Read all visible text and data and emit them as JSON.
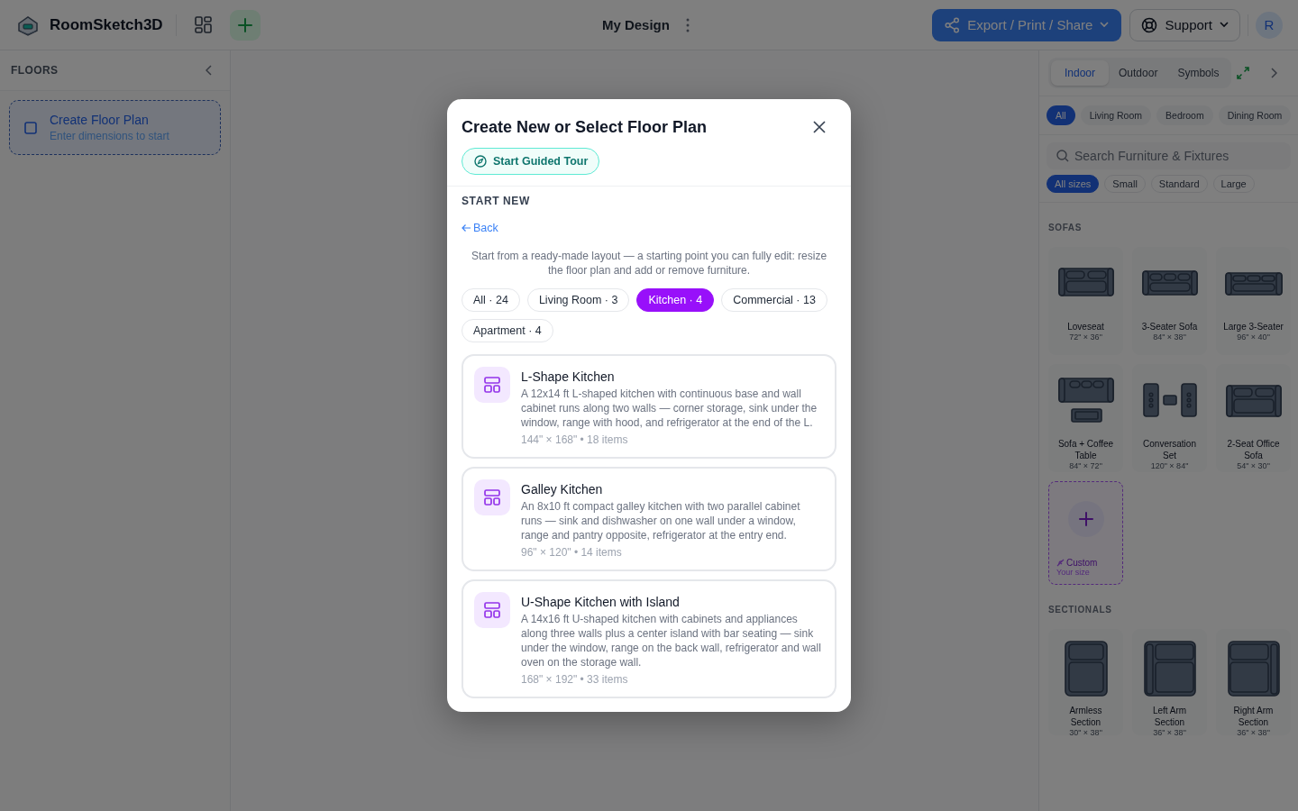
{
  "header": {
    "logo_text": "RoomSketch3D",
    "title": "My Design",
    "export_button": "Export / Print / Share",
    "support_button": "Support",
    "avatar": "R"
  },
  "sidebar": {
    "heading": "FLOORS",
    "create_card": {
      "title": "Create Floor Plan",
      "subtitle": "Enter dimensions to start"
    }
  },
  "library": {
    "tabs": [
      {
        "label": "Indoor",
        "selected": true
      },
      {
        "label": "Outdoor",
        "selected": false
      },
      {
        "label": "Symbols",
        "selected": false
      }
    ],
    "categories": [
      {
        "label": "All",
        "selected": true
      },
      {
        "label": "Living Room",
        "selected": false
      },
      {
        "label": "Bedroom",
        "selected": false
      },
      {
        "label": "Dining Room",
        "selected": false
      }
    ],
    "search": {
      "placeholder": "Search Furniture & Fixtures"
    },
    "sizes": [
      {
        "label": "All sizes",
        "selected": true
      },
      {
        "label": "Small",
        "selected": false
      },
      {
        "label": "Standard",
        "selected": false
      },
      {
        "label": "Large",
        "selected": false
      }
    ],
    "sections": [
      {
        "heading": "SOFAS",
        "items": [
          {
            "kind": "loveseat",
            "name": "Loveseat",
            "size": "72\" × 36\""
          },
          {
            "kind": "sofa3",
            "name": "3-Seater Sofa",
            "size": "84\" × 38\""
          },
          {
            "kind": "large3",
            "name": "Large 3-Seater",
            "size": "96\" × 40\""
          },
          {
            "kind": "sofa-table",
            "name": "Sofa + Coffee Table",
            "size": "84\" × 72\""
          },
          {
            "kind": "conversation",
            "name": "Conversation Set",
            "size": "120\" × 84\""
          },
          {
            "kind": "office2",
            "name": "2-Seat Office Sofa",
            "size": "54\" × 30\""
          },
          {
            "kind": "custom",
            "name": "Custom",
            "size": "Your size"
          }
        ]
      },
      {
        "heading": "SECTIONALS",
        "items": [
          {
            "kind": "armless",
            "name": "Armless Section",
            "size": "30\" × 38\""
          },
          {
            "kind": "left-arm",
            "name": "Left Arm Section",
            "size": "36\" × 38\""
          },
          {
            "kind": "right-arm",
            "name": "Right Arm Section",
            "size": "36\" × 38\""
          }
        ]
      }
    ]
  },
  "modal": {
    "title": "Create New or Select Floor Plan",
    "tour_button": "Start Guided Tour",
    "section_label": "START NEW",
    "back_link": "Back",
    "description": "Start from a ready-made layout — a starting point you can fully edit: resize the floor plan and add or remove furniture.",
    "filters": [
      {
        "label": "All · 24",
        "selected": false
      },
      {
        "label": "Living Room · 3",
        "selected": false
      },
      {
        "label": "Kitchen · 4",
        "selected": true
      },
      {
        "label": "Commercial · 13",
        "selected": false
      },
      {
        "label": "Apartment · 4",
        "selected": false
      }
    ],
    "templates": [
      {
        "title": "L-Shape Kitchen",
        "description": "A 12x14 ft L-shaped kitchen with continuous base and wall cabinet runs along two walls — corner storage, sink under the window, range with hood, and refrigerator at the end of the L.",
        "meta": "144\" × 168\" • 18 items"
      },
      {
        "title": "Galley Kitchen",
        "description": "An 8x10 ft compact galley kitchen with two parallel cabinet runs — sink and dishwasher on one wall under a window, range and pantry opposite, refrigerator at the entry end.",
        "meta": "96\" × 120\" • 14 items"
      },
      {
        "title": "U-Shape Kitchen with Island",
        "description": "A 14x16 ft U-shaped kitchen with cabinets and appliances along three walls plus a center island with bar seating — sink under the window, range on the back wall, refrigerator and wall oven on the storage wall.",
        "meta": "168\" × 192\" • 33 items"
      }
    ]
  }
}
